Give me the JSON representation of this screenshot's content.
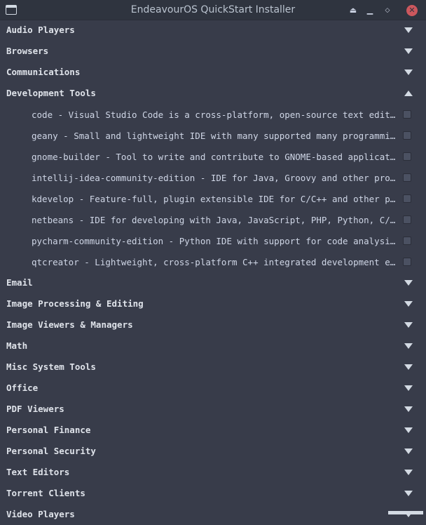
{
  "window": {
    "title": "EndeavourOS QuickStart Installer",
    "icons": {
      "app": "app-window-icon",
      "shade": "eject-icon",
      "minimize": "minimize-icon",
      "maximize": "maximize-icon",
      "close": "close-icon"
    },
    "buttons": {
      "shade": "⏏",
      "minimize": "▁",
      "maximize": "◇",
      "close": "✕"
    }
  },
  "colors": {
    "background": "#383c4a",
    "titlebar": "#2f343f",
    "close": "#cc575d",
    "text": "#d3dae3"
  },
  "categories": [
    {
      "label": "Audio Players",
      "expanded": false
    },
    {
      "label": "Browsers",
      "expanded": false
    },
    {
      "label": "Communications",
      "expanded": false
    },
    {
      "label": "Development Tools",
      "expanded": true,
      "items": [
        {
          "label": "code - Visual Studio Code is a cross-platform, open-source text editor s…",
          "checked": false
        },
        {
          "label": "geany - Small and lightweight IDE with many supported many programming a…",
          "checked": false
        },
        {
          "label": "gnome-builder - Tool to write and contribute to GNOME-based applications",
          "checked": false
        },
        {
          "label": "intellij-idea-community-edition - IDE for Java, Groovy and other program…",
          "checked": false
        },
        {
          "label": "kdevelop - Feature-full, plugin extensible IDE for C/C++ and other progr…",
          "checked": false
        },
        {
          "label": "netbeans - IDE for developing with Java, JavaScript, PHP, Python, C/C++,…",
          "checked": false
        },
        {
          "label": "pycharm-community-edition - Python IDE with support for code analysis, d…",
          "checked": false
        },
        {
          "label": "qtcreator - Lightweight, cross-platform C++ integrated development envir…",
          "checked": false
        }
      ]
    },
    {
      "label": "Email",
      "expanded": false
    },
    {
      "label": "Image Processing & Editing",
      "expanded": false
    },
    {
      "label": "Image Viewers & Managers",
      "expanded": false
    },
    {
      "label": "Math",
      "expanded": false
    },
    {
      "label": "Misc System Tools",
      "expanded": false
    },
    {
      "label": "Office",
      "expanded": false
    },
    {
      "label": "PDF Viewers",
      "expanded": false
    },
    {
      "label": "Personal Finance",
      "expanded": false
    },
    {
      "label": "Personal Security",
      "expanded": false
    },
    {
      "label": "Text Editors",
      "expanded": false
    },
    {
      "label": "Torrent Clients",
      "expanded": false
    },
    {
      "label": "Video Players",
      "expanded": false
    }
  ]
}
